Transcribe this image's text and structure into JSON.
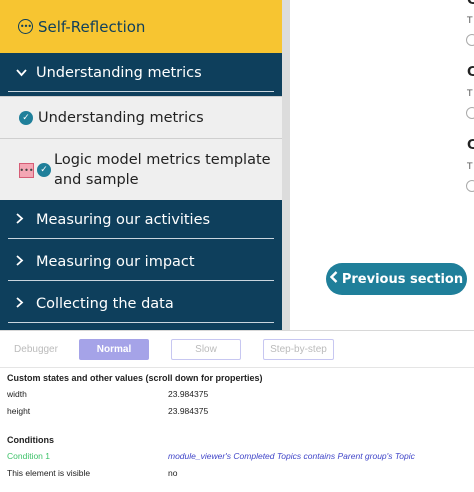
{
  "sidebar": {
    "self_reflection": "Self-Reflection",
    "sections": [
      {
        "label": "Understanding metrics",
        "expanded": true
      },
      {
        "label": "Measuring our activities",
        "expanded": false
      },
      {
        "label": "Measuring our impact",
        "expanded": false
      },
      {
        "label": "Collecting the data",
        "expanded": false
      }
    ],
    "items": [
      {
        "label": "Understanding metrics",
        "completed": true
      },
      {
        "label": "Logic model metrics template and sample",
        "completed": true
      }
    ]
  },
  "right_pane": {
    "headings": [
      "C",
      "C",
      "C"
    ],
    "small": [
      "T",
      "T",
      "T"
    ],
    "previous_section": "Previous section"
  },
  "debug_bar": {
    "tabs": [
      "Debugger",
      "Normal",
      "Slow",
      "Step-by-step"
    ],
    "active": "Normal"
  },
  "inspector": {
    "states_title": "Custom states and other values (scroll down for properties)",
    "properties": [
      {
        "key": "width",
        "value": "23.984375"
      },
      {
        "key": "height",
        "value": "23.984375"
      }
    ],
    "conditions_title": "Conditions",
    "conditions": [
      {
        "key": "Condition 1",
        "value": "module_viewer's Completed Topics contains Parent group's Topic"
      },
      {
        "key": "This element is visible",
        "value": "no"
      }
    ]
  },
  "colors": {
    "sidebar": "#0e3f5c",
    "self_reflection": "#f7c531",
    "accent": "#1f7f9a",
    "debug_active": "#a5a3e8"
  }
}
